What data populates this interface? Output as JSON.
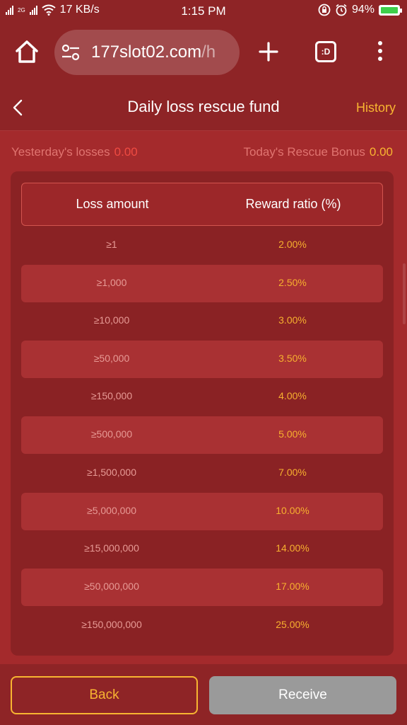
{
  "status_bar": {
    "network": "2G",
    "speed": "17 KB/s",
    "time": "1:15 PM",
    "battery": "94%"
  },
  "browser": {
    "url_main": "177slot02.com",
    "url_rest": "/h",
    "tabs_label": ":D"
  },
  "header": {
    "title": "Daily loss rescue fund",
    "history": "History"
  },
  "summary": {
    "yesterday_label": "Yesterday's losses",
    "yesterday_value": "0.00",
    "today_label": "Today's Rescue Bonus",
    "today_value": "0.00"
  },
  "table": {
    "headers": [
      "Loss amount",
      "Reward ratio (%)"
    ],
    "rows": [
      {
        "amount": "≥1",
        "ratio": "2.00%"
      },
      {
        "amount": "≥1,000",
        "ratio": "2.50%"
      },
      {
        "amount": "≥10,000",
        "ratio": "3.00%"
      },
      {
        "amount": "≥50,000",
        "ratio": "3.50%"
      },
      {
        "amount": "≥150,000",
        "ratio": "4.00%"
      },
      {
        "amount": "≥500,000",
        "ratio": "5.00%"
      },
      {
        "amount": "≥1,500,000",
        "ratio": "7.00%"
      },
      {
        "amount": "≥5,000,000",
        "ratio": "10.00%"
      },
      {
        "amount": "≥15,000,000",
        "ratio": "14.00%"
      },
      {
        "amount": "≥50,000,000",
        "ratio": "17.00%"
      },
      {
        "amount": "≥150,000,000",
        "ratio": "25.00%"
      }
    ]
  },
  "footer": {
    "back": "Back",
    "receive": "Receive"
  },
  "colors": {
    "background": "#8e2426",
    "accent": "#f8b531",
    "loss_value": "#ef4b42",
    "disabled_button": "#9a9a9a"
  }
}
